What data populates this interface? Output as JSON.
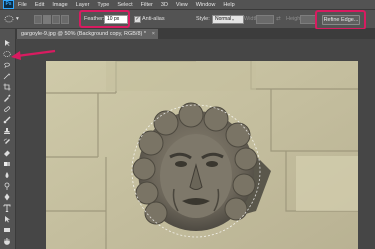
{
  "app": {
    "logo": "Ps"
  },
  "menu": [
    "File",
    "Edit",
    "Image",
    "Layer",
    "Type",
    "Select",
    "Filter",
    "3D",
    "View",
    "Window",
    "Help"
  ],
  "options": {
    "feather_label": "Feather:",
    "feather_value": "10 px",
    "antialias_label": "Anti-alias",
    "style_label": "Style:",
    "style_value": "Normal",
    "width_label": "Width:",
    "height_label": "Height:",
    "refine_label": "Refine Edge..."
  },
  "document": {
    "tab_title": "gargoyle-9.jpg @ 50% (Background copy, RGB/8) *",
    "close": "×"
  },
  "colors": {
    "highlight": "#d81b60",
    "panel": "#535353",
    "canvas": "#464646"
  },
  "icons": [
    "ellipse-marquee-icon",
    "move-icon",
    "lasso-icon",
    "magic-wand-icon",
    "crop-icon",
    "eyedropper-icon",
    "brush-icon",
    "eraser-icon",
    "type-icon",
    "hand-icon",
    "zoom-icon"
  ]
}
